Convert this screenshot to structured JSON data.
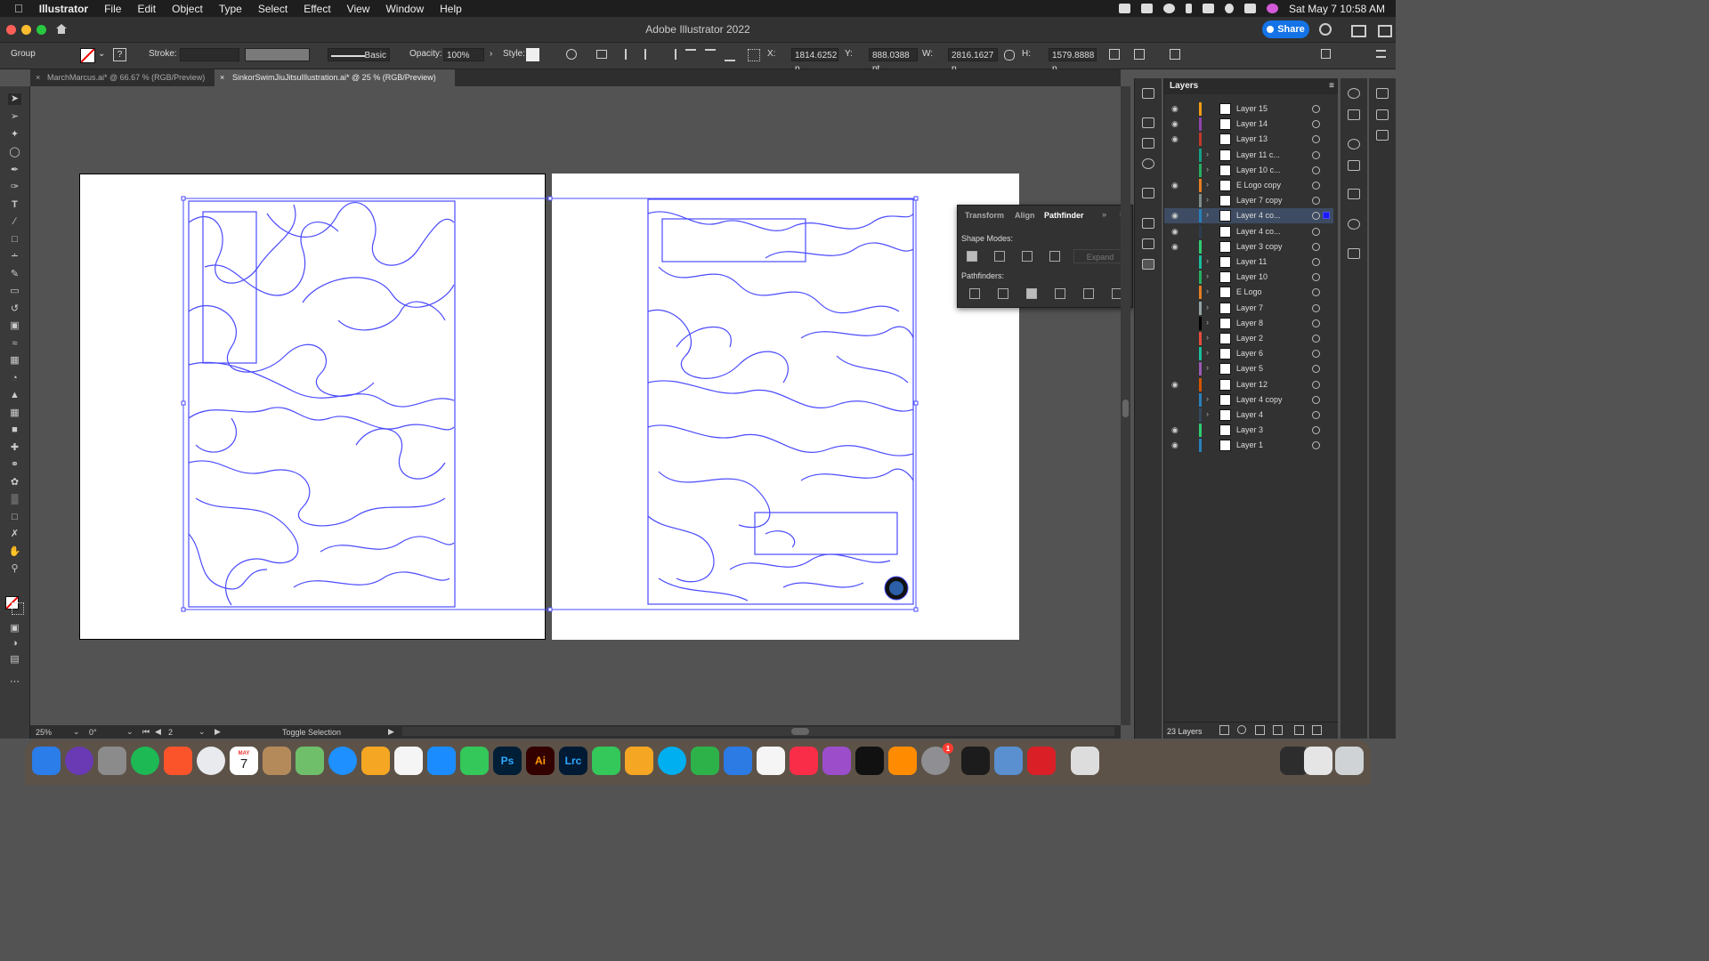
{
  "menubar": {
    "items": [
      "Illustrator",
      "File",
      "Edit",
      "Object",
      "Type",
      "Select",
      "Effect",
      "View",
      "Window",
      "Help"
    ],
    "clock": "Sat May 7  10:58 AM"
  },
  "window": {
    "title": "Adobe Illustrator 2022",
    "share_label": "Share"
  },
  "controlbar": {
    "selection_type": "Group",
    "stroke_label": "Stroke:",
    "brush_label": "Basic",
    "opacity_label": "Opacity:",
    "opacity_value": "100%",
    "style_label": "Style:",
    "x_label": "X:",
    "x_value": "1814.6252 p",
    "y_label": "Y:",
    "y_value": "888.0388 pt",
    "w_label": "W:",
    "w_value": "2816.1627 p",
    "h_label": "H:",
    "h_value": "1579.8888 p",
    "stroke_hint": "?"
  },
  "tabs": [
    {
      "label": "MarchMarcus.ai* @ 66.67 % (RGB/Preview)"
    },
    {
      "label": "SinkorSwimJiuJitsuIllustration.ai* @ 25 % (RGB/Preview)"
    }
  ],
  "pathfinder": {
    "tabs": [
      "Transform",
      "Align",
      "Pathfinder"
    ],
    "shape_modes_label": "Shape Modes:",
    "expand_label": "Expand",
    "pathfinders_label": "Pathfinders:"
  },
  "layers": {
    "title": "Layers",
    "count_label": "23 Layers",
    "rows": [
      {
        "name": "Layer 15",
        "visible": true,
        "color": "#f39c12",
        "expandable": false,
        "selected": false
      },
      {
        "name": "Layer 14",
        "visible": true,
        "color": "#8e44ad",
        "expandable": false,
        "selected": false
      },
      {
        "name": "Layer 13",
        "visible": true,
        "color": "#c0392b",
        "expandable": false,
        "selected": false
      },
      {
        "name": "Layer 11 c...",
        "visible": false,
        "color": "#16a085",
        "expandable": true,
        "selected": false
      },
      {
        "name": "Layer 10 c...",
        "visible": false,
        "color": "#27ae60",
        "expandable": true,
        "selected": false
      },
      {
        "name": "E Logo copy",
        "visible": true,
        "color": "#e67e22",
        "expandable": true,
        "selected": false
      },
      {
        "name": "Layer 7 copy",
        "visible": false,
        "color": "#7f8c8d",
        "expandable": true,
        "selected": false
      },
      {
        "name": "Layer 4 co...",
        "visible": true,
        "color": "#2980b9",
        "expandable": true,
        "selected": true
      },
      {
        "name": "Layer 4 co...",
        "visible": true,
        "color": "#2c3e50",
        "expandable": false,
        "selected": false
      },
      {
        "name": "Layer 3 copy",
        "visible": true,
        "color": "#2ecc71",
        "expandable": false,
        "selected": false
      },
      {
        "name": "Layer 11",
        "visible": false,
        "color": "#1abc9c",
        "expandable": true,
        "selected": false
      },
      {
        "name": "Layer 10",
        "visible": false,
        "color": "#27ae60",
        "expandable": true,
        "selected": false
      },
      {
        "name": "E Logo",
        "visible": false,
        "color": "#e67e22",
        "expandable": true,
        "selected": false
      },
      {
        "name": "Layer 7",
        "visible": false,
        "color": "#95a5a6",
        "expandable": true,
        "selected": false
      },
      {
        "name": "Layer 8",
        "visible": false,
        "color": "#000000",
        "expandable": true,
        "selected": false
      },
      {
        "name": "Layer 2",
        "visible": false,
        "color": "#e74c3c",
        "expandable": true,
        "selected": false
      },
      {
        "name": "Layer 6",
        "visible": false,
        "color": "#1abc9c",
        "expandable": true,
        "selected": false
      },
      {
        "name": "Layer 5",
        "visible": false,
        "color": "#9b59b6",
        "expandable": true,
        "selected": false
      },
      {
        "name": "Layer 12",
        "visible": true,
        "color": "#d35400",
        "expandable": false,
        "selected": false
      },
      {
        "name": "Layer 4 copy",
        "visible": false,
        "color": "#2980b9",
        "expandable": true,
        "selected": false
      },
      {
        "name": "Layer 4",
        "visible": false,
        "color": "#34495e",
        "expandable": true,
        "selected": false
      },
      {
        "name": "Layer 3",
        "visible": true,
        "color": "#2ecc71",
        "expandable": false,
        "selected": false
      },
      {
        "name": "Layer 1",
        "visible": true,
        "color": "#2980b9",
        "expandable": false,
        "selected": false
      }
    ]
  },
  "statusbar": {
    "zoom": "25%",
    "rotation": "0°",
    "artboard_number": "2",
    "status_text": "Toggle Selection"
  },
  "dock": {
    "calendar_month": "MAY",
    "calendar_day": "7",
    "photoshop_label": "Ps",
    "illustrator_label": "Ai",
    "lightroom_label": "Lrc",
    "notification_badge": "1"
  },
  "colors": {
    "accent": "#1473e6",
    "selection": "#4b4bff",
    "canvas": "#535353"
  }
}
